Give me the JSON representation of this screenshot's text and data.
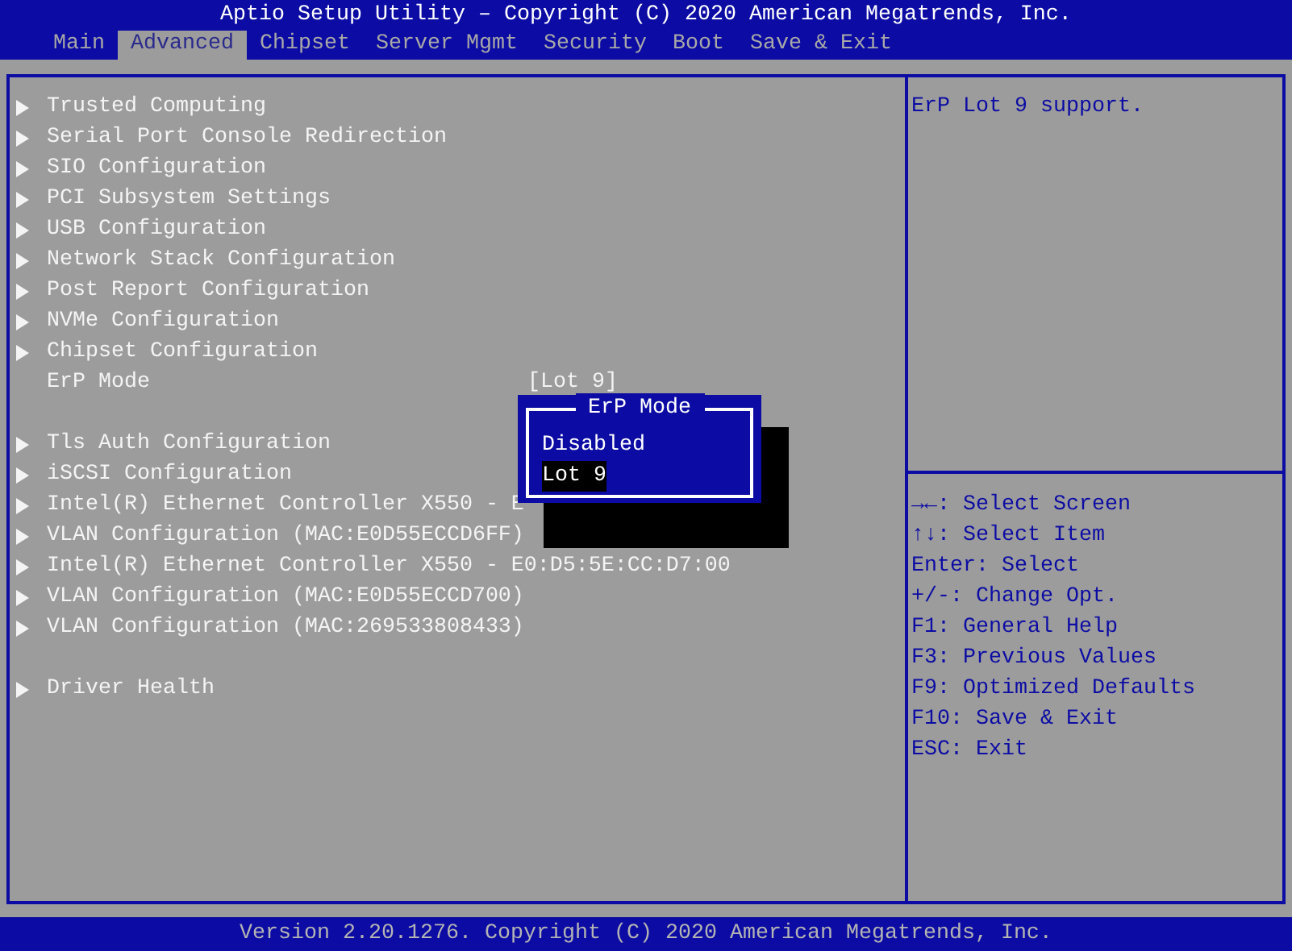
{
  "window": {
    "title": "Aptio Setup Utility – Copyright (C) 2020 American Megatrends, Inc."
  },
  "tabs": [
    {
      "label": "Main",
      "selected": false
    },
    {
      "label": "Advanced",
      "selected": true
    },
    {
      "label": "Chipset",
      "selected": false
    },
    {
      "label": "Server Mgmt",
      "selected": false
    },
    {
      "label": "Security",
      "selected": false
    },
    {
      "label": "Boot",
      "selected": false
    },
    {
      "label": "Save & Exit",
      "selected": false
    }
  ],
  "menu_sections": [
    [
      {
        "kind": "submenu",
        "label": "Trusted Computing"
      },
      {
        "kind": "submenu",
        "label": "Serial Port Console Redirection"
      },
      {
        "kind": "submenu",
        "label": "SIO Configuration"
      },
      {
        "kind": "submenu",
        "label": "PCI Subsystem Settings"
      },
      {
        "kind": "submenu",
        "label": "USB Configuration"
      },
      {
        "kind": "submenu",
        "label": "Network Stack Configuration"
      },
      {
        "kind": "submenu",
        "label": "Post Report Configuration"
      },
      {
        "kind": "submenu",
        "label": "NVMe Configuration"
      },
      {
        "kind": "submenu",
        "label": "Chipset Configuration"
      },
      {
        "kind": "setting",
        "label": "ErP Mode",
        "value": "[Lot 9]"
      }
    ],
    [
      {
        "kind": "submenu",
        "label": "Tls Auth Configuration"
      },
      {
        "kind": "submenu",
        "label": "iSCSI Configuration"
      },
      {
        "kind": "submenu",
        "label": "Intel(R) Ethernet Controller X550 - E"
      },
      {
        "kind": "submenu",
        "label": "VLAN Configuration (MAC:E0D55ECCD6FF)"
      },
      {
        "kind": "submenu",
        "label": "Intel(R) Ethernet Controller X550 - E0:D5:5E:CC:D7:00"
      },
      {
        "kind": "submenu",
        "label": "VLAN Configuration (MAC:E0D55ECCD700)"
      },
      {
        "kind": "submenu",
        "label": "VLAN Configuration (MAC:269533808433)"
      }
    ],
    [
      {
        "kind": "submenu",
        "label": "Driver Health"
      }
    ]
  ],
  "popup": {
    "title": "ErP Mode",
    "options": [
      {
        "label": "Disabled",
        "selected": false
      },
      {
        "label": "Lot 9",
        "selected": true
      }
    ]
  },
  "help_text": "ErP Lot 9 support.",
  "key_help": [
    {
      "key": "→←:",
      "action": "Select Screen"
    },
    {
      "key": "↑↓:",
      "action": "Select Item"
    },
    {
      "key": "Enter:",
      "action": "Select"
    },
    {
      "key": "+/-:",
      "action": "Change Opt."
    },
    {
      "key": "F1:",
      "action": "General Help"
    },
    {
      "key": "F3:",
      "action": "Previous Values"
    },
    {
      "key": "F9:",
      "action": "Optimized Defaults"
    },
    {
      "key": "F10:",
      "action": "Save & Exit"
    },
    {
      "key": "ESC:",
      "action": "Exit"
    }
  ],
  "status_bar": "Version 2.20.1276. Copyright (C) 2020 American Megatrends, Inc."
}
